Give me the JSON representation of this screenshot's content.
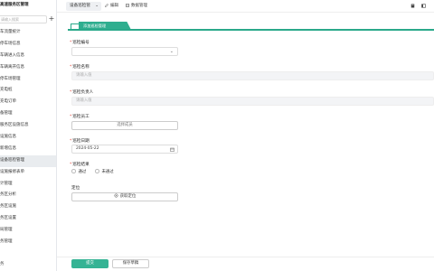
{
  "sidebar": {
    "brand": "高速服务区管理",
    "search_placeholder": "请输入搜索",
    "add": "+",
    "items": [
      {
        "label": "车流量统计"
      },
      {
        "label": "停车场信息"
      },
      {
        "label": "车辆进入信息"
      },
      {
        "label": "车辆离开信息"
      },
      {
        "label": "停车场管理"
      },
      {
        "label": "充电桩"
      },
      {
        "label": "充电订单"
      },
      {
        "label": "备管理"
      },
      {
        "label": "服务区设施信息"
      },
      {
        "label": "设施信息"
      },
      {
        "label": "新增信息"
      },
      {
        "label": "设备巡检管理"
      },
      {
        "label": "设施报修表单"
      },
      {
        "label": "计管理"
      },
      {
        "label": "务区分析"
      },
      {
        "label": "务区设施"
      },
      {
        "label": "务区设置"
      },
      {
        "label": "局管理"
      },
      {
        "label": "务管理"
      }
    ],
    "active_index": 11,
    "footer": "务"
  },
  "topbar": {
    "selector": "设备巡检管",
    "edit": "编辑",
    "data_manage": "数据管理"
  },
  "form": {
    "tab_label": "添加巡检管理",
    "fields": {
      "code": {
        "label": "巡检编号",
        "value": ""
      },
      "name": {
        "label": "巡检名称",
        "placeholder": "请输入值"
      },
      "owner": {
        "label": "巡检负责人",
        "placeholder": "请输入值"
      },
      "worker": {
        "label": "巡检员工",
        "button": "选择成员"
      },
      "date": {
        "label": "巡检日期",
        "value": "2024-05-22"
      },
      "result": {
        "label": "巡检结果",
        "options": [
          "通过",
          "未通过"
        ]
      },
      "location": {
        "label": "定位",
        "button": "获取定位"
      }
    }
  },
  "footer": {
    "submit": "提交",
    "save_draft": "保存草稿"
  },
  "colors": {
    "accent": "#35b394",
    "required": "#e54d42"
  }
}
